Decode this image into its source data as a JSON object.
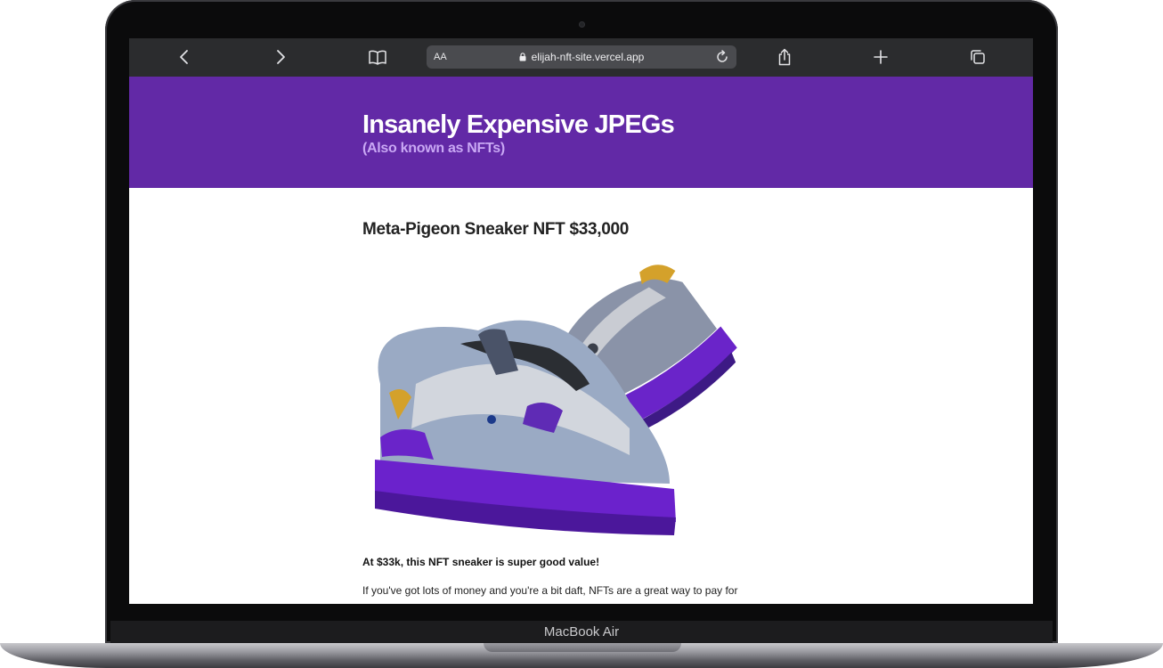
{
  "device": {
    "model_label": "MacBook Air"
  },
  "browser": {
    "address_bar": {
      "text_size_label": "AA",
      "url": "elijah-nft-site.vercel.app"
    },
    "icons": [
      "back-icon",
      "forward-icon",
      "bookmarks-icon",
      "lock-icon",
      "reload-icon",
      "share-icon",
      "new-tab-icon",
      "tabs-icon"
    ]
  },
  "page": {
    "header": {
      "title": "Insanely Expensive JPEGs",
      "subtitle": "(Also known as NFTs)",
      "background_color": "#6229a6"
    },
    "post": {
      "title": "Meta-Pigeon Sneaker NFT $33,000",
      "lead": "At $33k, this NFT sneaker is super good value!",
      "body": "If you've got lots of money and you're a bit daft, NFTs are a great way to pay for"
    }
  }
}
